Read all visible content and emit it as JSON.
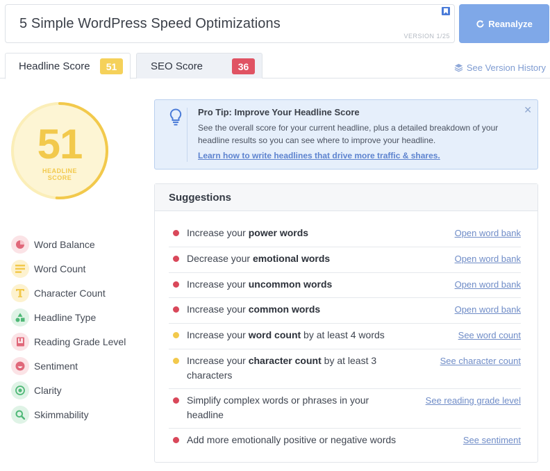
{
  "headline": {
    "text": "5 Simple WordPress Speed Optimizations",
    "version": "VERSION 1/25"
  },
  "reanalyze_label": "Reanalyze",
  "tabs": [
    {
      "label": "Headline Score",
      "score": "51"
    },
    {
      "label": "SEO Score",
      "score": "36"
    }
  ],
  "version_history_label": "See Version History",
  "score": {
    "value": "51",
    "label_line1": "HEADLINE",
    "label_line2": "SCORE",
    "fraction": 0.51
  },
  "metrics": [
    {
      "label": "Word Balance",
      "icon": "pie-chart-icon"
    },
    {
      "label": "Word Count",
      "icon": "lines-icon"
    },
    {
      "label": "Character Count",
      "icon": "letter-t-icon"
    },
    {
      "label": "Headline Type",
      "icon": "shapes-icon"
    },
    {
      "label": "Reading Grade Level",
      "icon": "book-icon"
    },
    {
      "label": "Sentiment",
      "icon": "smile-icon"
    },
    {
      "label": "Clarity",
      "icon": "target-icon"
    },
    {
      "label": "Skimmability",
      "icon": "magnifier-icon"
    }
  ],
  "protip": {
    "title": "Pro Tip: Improve Your Headline Score",
    "body": "See the overall score for your current headline, plus a detailed breakdown of your headline results so you can see where to improve your headline.",
    "link": "Learn how to write headlines that drive more traffic & shares."
  },
  "suggestions": {
    "title": "Suggestions",
    "items": [
      {
        "status": "red",
        "pre": "Increase your ",
        "bold": "power words",
        "post": "",
        "link": "Open word bank"
      },
      {
        "status": "red",
        "pre": "Decrease your ",
        "bold": "emotional words",
        "post": "",
        "link": "Open word bank"
      },
      {
        "status": "red",
        "pre": "Increase your ",
        "bold": "uncommon words",
        "post": "",
        "link": "Open word bank"
      },
      {
        "status": "red",
        "pre": "Increase your ",
        "bold": "common words",
        "post": "",
        "link": "Open word bank"
      },
      {
        "status": "yellow",
        "pre": "Increase your ",
        "bold": "word count",
        "post": " by at least 4 words",
        "link": "See word count"
      },
      {
        "status": "yellow",
        "pre": "Increase your ",
        "bold": "character count",
        "post": " by at least 3 characters",
        "link": "See character count"
      },
      {
        "status": "red",
        "pre": "Simplify complex words or phrases in your headline",
        "bold": "",
        "post": "",
        "link": "See reading grade level"
      },
      {
        "status": "red",
        "pre": "Add more emotionally positive or negative words",
        "bold": "",
        "post": "",
        "link": "See sentiment"
      }
    ]
  },
  "colors": {
    "accent_blue": "#7fa8e8",
    "score_yellow": "#f2c94c",
    "status_red": "#d9485a",
    "status_yellow": "#f2c94c"
  }
}
